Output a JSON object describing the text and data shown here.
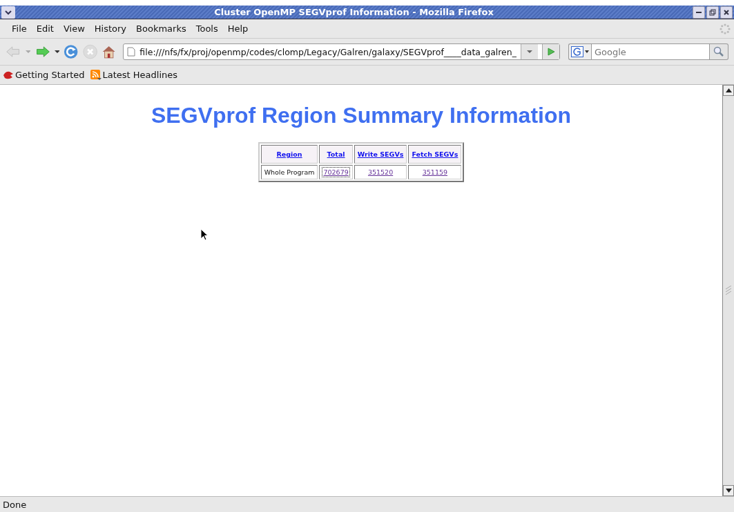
{
  "window": {
    "title": "Cluster OpenMP SEGVprof Information - Mozilla Firefox"
  },
  "menu": [
    "File",
    "Edit",
    "View",
    "History",
    "Bookmarks",
    "Tools",
    "Help"
  ],
  "address_bar": {
    "value": "file:///nfs/fx/proj/openmp/codes/clomp/Legacy/Galren/galaxy/SEGVprof____data_galren_"
  },
  "search": {
    "placeholder": "Google"
  },
  "bookmarks": [
    {
      "label": "Getting Started",
      "kind": "site"
    },
    {
      "label": "Latest Headlines",
      "kind": "feed"
    }
  ],
  "page": {
    "heading": "SEGVprof Region Summary Information",
    "table": {
      "columns": [
        "Region",
        "Total",
        "Write SEGVs",
        "Fetch SEGVs"
      ],
      "rows": [
        [
          {
            "text": "Whole Program",
            "kind": "text",
            "focused": false
          },
          {
            "text": "702679",
            "kind": "link",
            "focused": true
          },
          {
            "text": "351520",
            "kind": "link",
            "focused": false
          },
          {
            "text": "351159",
            "kind": "link",
            "focused": false
          }
        ]
      ]
    }
  },
  "status_bar": {
    "text": "Done"
  }
}
